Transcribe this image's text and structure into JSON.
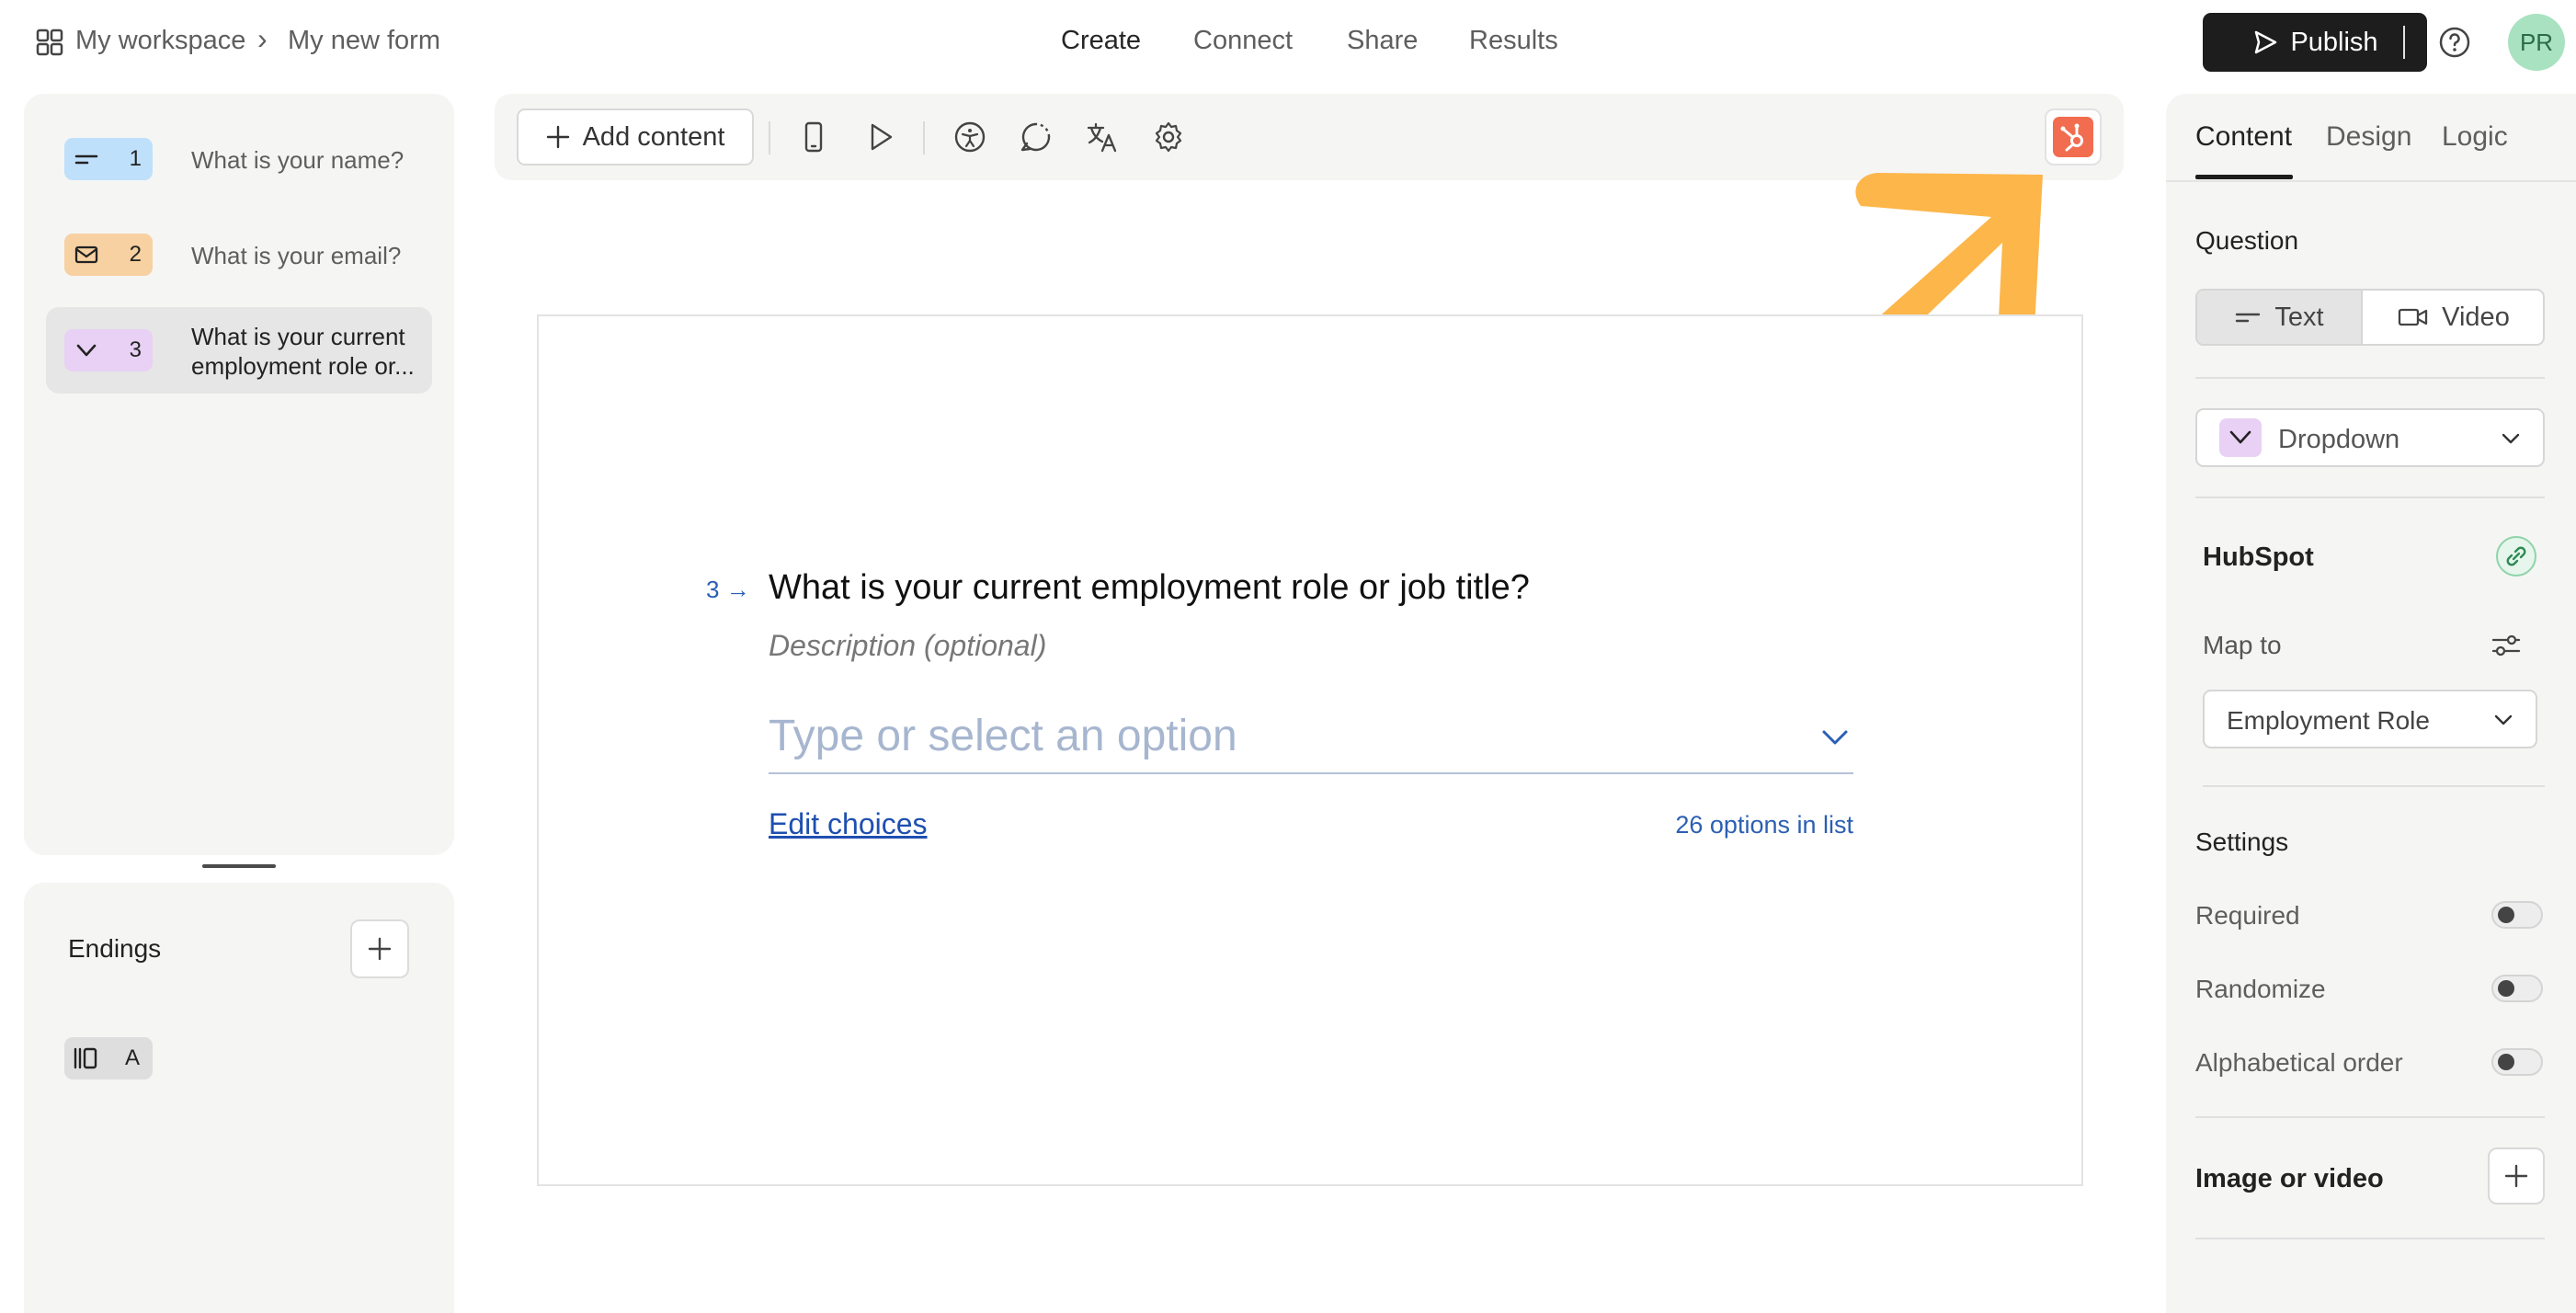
{
  "breadcrumb": {
    "workspace": "My workspace",
    "separator": "›",
    "form": "My new form"
  },
  "nav": {
    "items": [
      "Create",
      "Connect",
      "Share",
      "Results"
    ],
    "active": "Create"
  },
  "header": {
    "publish_label": "Publish",
    "avatar_initials": "PR"
  },
  "sidebar": {
    "questions": [
      {
        "number": "1",
        "label": "What is your name?",
        "icon": "short-text-icon",
        "color": "#bfe0fb"
      },
      {
        "number": "2",
        "label": "What is your email?",
        "icon": "email-icon",
        "color": "#f7d1a1"
      },
      {
        "number": "3",
        "label_line1": "What is your current",
        "label_line2": "employment role or...",
        "icon": "dropdown-icon",
        "color": "#e8d1f4"
      }
    ],
    "endings_title": "Endings",
    "ending_badge": "A"
  },
  "toolbar": {
    "add_content_label": "Add content"
  },
  "question": {
    "number": "3",
    "title": "What is your current employment role or job title?",
    "description_placeholder": "Description (optional)",
    "dropdown_placeholder": "Type or select an option",
    "edit_choices": "Edit choices",
    "options_count": "26 options in list"
  },
  "right_panel": {
    "tabs": [
      "Content",
      "Design",
      "Logic"
    ],
    "active_tab": "Content",
    "question_section": "Question",
    "segment": [
      "Text",
      "Video"
    ],
    "question_type": "Dropdown",
    "hubspot_title": "HubSpot",
    "map_to_label": "Map to",
    "map_to_value": "Employment Role",
    "settings_title": "Settings",
    "settings": [
      {
        "label": "Required",
        "on": false
      },
      {
        "label": "Randomize",
        "on": false
      },
      {
        "label": "Alphabetical order",
        "on": false
      }
    ],
    "image_video_title": "Image or video"
  },
  "colors": {
    "hubspot_orange": "#f26c4f",
    "annotation_arrow": "#fdb64a",
    "link_blue": "#1f4fb0"
  }
}
